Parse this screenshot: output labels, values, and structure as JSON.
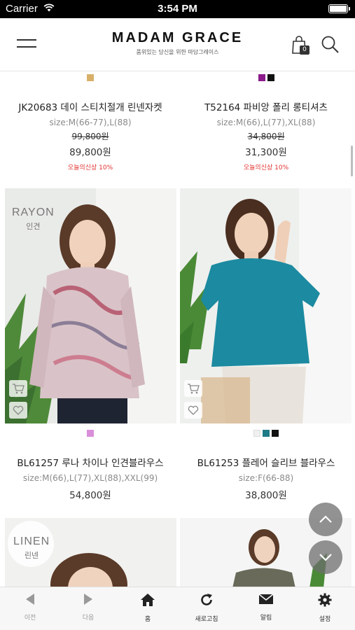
{
  "status": {
    "carrier": "Carrier",
    "time": "3:54 PM"
  },
  "header": {
    "logo": "MADAM GRACE",
    "tagline": "품위있는 당신을 위한 마담그레이스",
    "cart_count": "0"
  },
  "products": [
    {
      "name": "JK20683 데이 스티치절개 린넨자켓",
      "size": "size:M(66-77),L(88)",
      "old_price": "99,800원",
      "price": "89,800원",
      "badge": "오늘의신상 10%",
      "swatches": [
        "#d8b06a"
      ]
    },
    {
      "name": "T52164 파비앙 폴리 롱티셔츠",
      "size": "size:M(66),L(77),XL(88)",
      "old_price": "34,800원",
      "price": "31,300원",
      "badge": "오늘의신상 10%",
      "swatches": [
        "#8b1a8b",
        "#111111"
      ]
    },
    {
      "name": "BL61257 루나 차이나 인견블라우스",
      "size": "size:M(66),L(77),XL(88),XXL(99)",
      "price": "54,800원",
      "fabric": "RAYON",
      "fabric_ko": "인견",
      "swatches": [
        "#d98ed9"
      ]
    },
    {
      "name": "BL61253 플레어 슬리브 블라우스",
      "size": "size:F(66-88)",
      "price": "38,800원",
      "swatches": [
        "#f0f0f0",
        "#1d7a86",
        "#111111"
      ]
    },
    {
      "fabric": "LINEN",
      "fabric_ko": "린넨"
    }
  ],
  "nav": {
    "prev": "이전",
    "next": "다음",
    "home": "홈",
    "refresh": "새로고침",
    "alarm": "알림",
    "settings": "설정"
  },
  "colors": {
    "accent_red": "#e0302d",
    "teal_blouse": "#1c8aa0"
  }
}
